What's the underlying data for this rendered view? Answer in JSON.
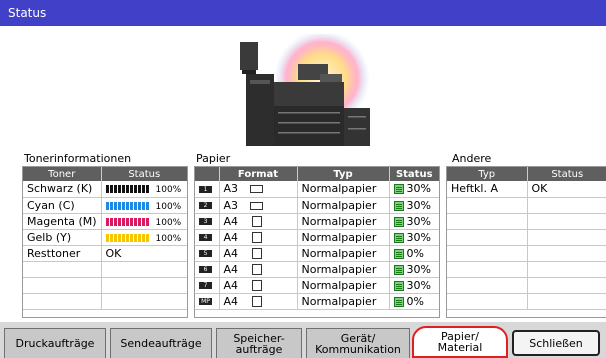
{
  "window": {
    "title": "Status"
  },
  "toner": {
    "heading": "Tonerinformationen",
    "col_toner": "Toner",
    "col_status": "Status",
    "rows": [
      {
        "name": "Schwarz (K)",
        "level": 100,
        "label": "100%",
        "color": "#111111"
      },
      {
        "name": "Cyan (C)",
        "level": 100,
        "label": "100%",
        "color": "#1e88e5"
      },
      {
        "name": "Magenta (M)",
        "level": 100,
        "label": "100%",
        "color": "#d81b60"
      },
      {
        "name": "Gelb (Y)",
        "level": 100,
        "label": "100%",
        "color": "#f6c700"
      }
    ],
    "waste": {
      "name": "Resttoner",
      "status": "OK"
    }
  },
  "paper": {
    "heading": "Papier",
    "col_format": "Format",
    "col_typ": "Typ",
    "col_status": "Status",
    "rows": [
      {
        "tray": "1",
        "format": "A3",
        "orientation": "landscape",
        "typ": "Normalpapier",
        "status": "30%"
      },
      {
        "tray": "2",
        "format": "A3",
        "orientation": "landscape",
        "typ": "Normalpapier",
        "status": "30%"
      },
      {
        "tray": "3",
        "format": "A4",
        "orientation": "portrait",
        "typ": "Normalpapier",
        "status": "30%"
      },
      {
        "tray": "4",
        "format": "A4",
        "orientation": "portrait",
        "typ": "Normalpapier",
        "status": "30%"
      },
      {
        "tray": "5",
        "format": "A4",
        "orientation": "portrait",
        "typ": "Normalpapier",
        "status": "0%"
      },
      {
        "tray": "6",
        "format": "A4",
        "orientation": "portrait",
        "typ": "Normalpapier",
        "status": "30%"
      },
      {
        "tray": "7",
        "format": "A4",
        "orientation": "portrait",
        "typ": "Normalpapier",
        "status": "30%"
      },
      {
        "tray": "MP",
        "format": "A4",
        "orientation": "portrait",
        "typ": "Normalpapier",
        "status": "0%"
      }
    ]
  },
  "other": {
    "heading": "Andere",
    "col_typ": "Typ",
    "col_status": "Status",
    "rows": [
      {
        "typ": "Heftkl. A",
        "status": "OK"
      }
    ]
  },
  "tabs": [
    {
      "label": "Druckaufträge"
    },
    {
      "label": "Sendeaufträge"
    },
    {
      "label": "Speicher-\naufträge"
    },
    {
      "label": "Gerät/\nKommunikation"
    },
    {
      "label": "Papier/\nMaterial"
    }
  ],
  "close_label": "Schließen"
}
